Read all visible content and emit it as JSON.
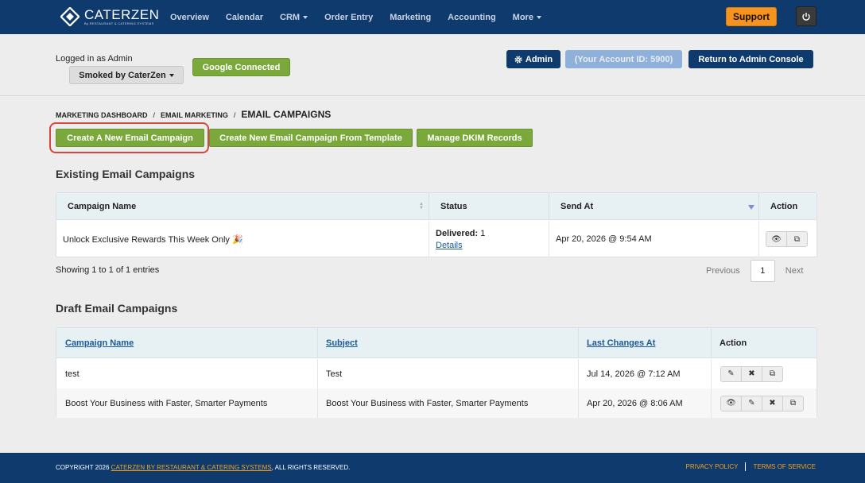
{
  "brand": {
    "name": "CATERZEN",
    "tagline": "By RESTAURANT & CATERING SYSTEMS"
  },
  "nav": {
    "items": [
      {
        "label": "Overview",
        "dropdown": false
      },
      {
        "label": "Calendar",
        "dropdown": false
      },
      {
        "label": "CRM",
        "dropdown": true
      },
      {
        "label": "Order Entry",
        "dropdown": false
      },
      {
        "label": "Marketing",
        "dropdown": false
      },
      {
        "label": "Accounting",
        "dropdown": false
      },
      {
        "label": "More",
        "dropdown": true
      }
    ],
    "support_label": "Support"
  },
  "header": {
    "logged_in": "Logged in as Admin",
    "store_selector": "Smoked by CaterZen",
    "google_status": "Google Connected",
    "admin_label": "Admin",
    "account_id": "(Your Account ID: 5900)",
    "return_label": "Return to Admin Console"
  },
  "breadcrumb": {
    "items": [
      "MARKETING DASHBOARD",
      "EMAIL MARKETING"
    ],
    "separator": "/",
    "current": "EMAIL CAMPAIGNS"
  },
  "actions": {
    "create_new": "Create A New Email Campaign",
    "create_from_template": "Create New Email Campaign From Template",
    "manage_dkim": "Manage DKIM Records"
  },
  "existing": {
    "title": "Existing Email Campaigns",
    "columns": [
      "Campaign Name",
      "Status",
      "Send At",
      "Action"
    ],
    "rows": [
      {
        "name": "Unlock Exclusive Rewards This Week Only 🎉",
        "status_label": "Delivered:",
        "status_count": "1",
        "details_link": "Details",
        "send_at": "Apr 20, 2026 @ 9:54 AM"
      }
    ],
    "showing": "Showing 1 to 1 of 1 entries",
    "pager": {
      "prev": "Previous",
      "page": "1",
      "next": "Next"
    }
  },
  "drafts": {
    "title": "Draft Email Campaigns",
    "columns": [
      "Campaign Name",
      "Subject",
      "Last Changes At",
      "Action"
    ],
    "rows": [
      {
        "name": "test",
        "subject": "Test",
        "last_changed": "Jul 14, 2026 @ 7:12 AM"
      },
      {
        "name": "Boost Your Business with Faster, Smarter Payments",
        "subject": "Boost Your Business with Faster, Smarter Payments",
        "last_changed": "Apr 20, 2026 @ 8:06 AM"
      }
    ]
  },
  "footer": {
    "copyright_prefix": "COPYRIGHT 2026",
    "company_link": "CATERZEN BY RESTAURANT & CATERING SYSTEMS",
    "copyright_suffix": ", ALL RIGHTS RESERVED.",
    "privacy": "PRIVACY POLICY",
    "terms": "TERMS OF SERVICE"
  },
  "colors": {
    "nav_bg": "#0e3a6e",
    "accent_green": "#7aa83a",
    "support_orange": "#f6921e",
    "highlight_red": "#d9463e",
    "link_blue": "#1a5a9a"
  }
}
